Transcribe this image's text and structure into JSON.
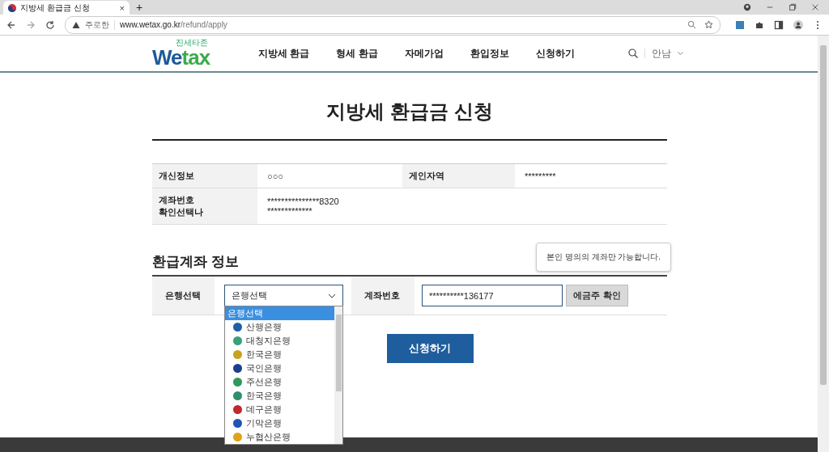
{
  "browser": {
    "tab_title": "지방세 환급금 신청",
    "tab_close": "×",
    "new_tab": "+",
    "security_label": "주로한",
    "url_host": "www.wetax.go.kr",
    "url_path": "/refund/apply"
  },
  "header": {
    "logo_small": "진세타존",
    "logo_a": "We",
    "logo_b": "tax",
    "nav": [
      "지방세 환급",
      "형세 환급",
      "자메가업",
      "환입정보",
      "신청하기"
    ],
    "language": "안남"
  },
  "title": "지방세 환급금 신청",
  "info": {
    "row1": [
      {
        "label": "개신정보",
        "value": "○○○"
      },
      {
        "label": "게인자역",
        "value": "*********"
      }
    ],
    "row2": {
      "label": [
        "계좌번호",
        "확인선택나"
      ],
      "values": [
        "***************8320",
        "*************"
      ]
    }
  },
  "section": {
    "title": "환급계좌 정보",
    "tooltip": "본인 명의의 계좌만 가능합니다.",
    "bank_label": "은행선택",
    "bank_value": "은행선택",
    "account_label": "계좌번호",
    "account_value": "**********136177",
    "verify_button": "에금주 확인"
  },
  "dropdown": [
    {
      "label": "은행선택",
      "selected": true
    },
    {
      "label": "산행은행",
      "selected": false,
      "color": "#1f5fa8"
    },
    {
      "label": "대청지은행",
      "selected": false,
      "color": "#3aa07a"
    },
    {
      "label": "한국은행",
      "selected": false,
      "color": "#c9a21e"
    },
    {
      "label": "국인은행",
      "selected": false,
      "color": "#1b3f8f"
    },
    {
      "label": "주선은행",
      "selected": false,
      "color": "#2e9a5a"
    },
    {
      "label": "한국은행",
      "selected": false,
      "color": "#2e8f6a"
    },
    {
      "label": "데구은행",
      "selected": false,
      "color": "#c2282f"
    },
    {
      "label": "기막은행",
      "selected": false,
      "color": "#1d56b5"
    },
    {
      "label": "누협산은행",
      "selected": false,
      "color": "#e0a21a"
    }
  ],
  "submit": "신청하기"
}
